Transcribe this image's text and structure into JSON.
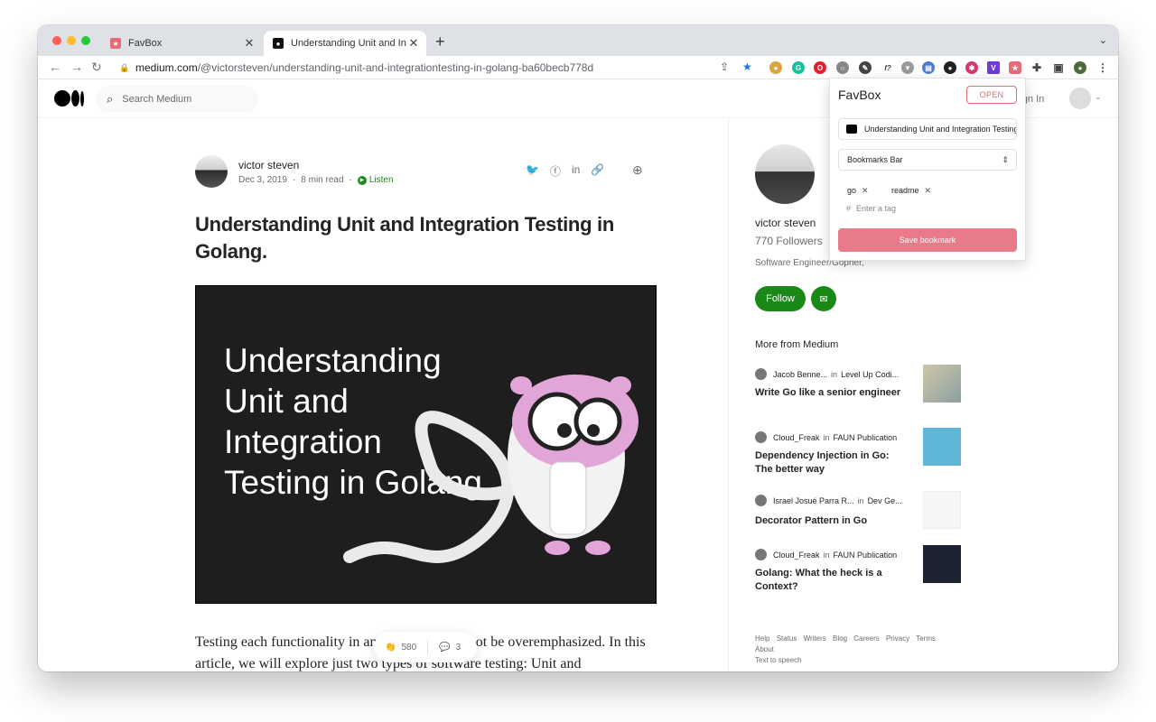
{
  "browser": {
    "tabs": [
      {
        "title": "FavBox",
        "favicon_color": "#e56b79"
      },
      {
        "title": "Understanding Unit and Integr",
        "favicon_color": "#111111"
      }
    ],
    "new_tab": "+",
    "tab_menu": "⌄",
    "url_host": "medium.com",
    "url_path": "/@victorsteven/understanding-unit-and-integrationtesting-in-golang-ba60becb778d",
    "traffic_colors": [
      "#ff5f57",
      "#febc2e",
      "#28c840"
    ]
  },
  "medium": {
    "search_placeholder": "Search Medium",
    "sign_in": "Sign In",
    "article": {
      "author": "victor steven",
      "date": "Dec 3, 2019",
      "read_time": "8 min read",
      "listen": "Listen",
      "title": "Understanding Unit and Integration Testing in Golang.",
      "hero_text": "Understanding Unit and Integration Testing in Golang",
      "body": "Testing each functionality in an application cannot be overemphasized. In this article, we will explore just two types of software testing: Unit and",
      "claps": "580",
      "comments": "3"
    },
    "sidebar": {
      "name": "victor steven",
      "followers": "770 Followers",
      "bio": "Software Engineer/Gopher,",
      "follow": "Follow",
      "more_from": "More from Medium",
      "recs": [
        {
          "author": "Jacob Benne...",
          "in": "in",
          "pub": "Level Up Codi...",
          "title": "Write Go like a senior engineer"
        },
        {
          "author": "Cloud_Freak",
          "in": "in",
          "pub": "FAUN Publication",
          "title": "Dependency Injection in Go: The better way"
        },
        {
          "author": "Israel Josué Parra R...",
          "in": "in",
          "pub": "Dev Ge...",
          "title": "Decorator Pattern in Go"
        },
        {
          "author": "Cloud_Freak",
          "in": "in",
          "pub": "FAUN Publication",
          "title": "Golang: What the heck is a Context?"
        }
      ],
      "footer": [
        "Help",
        "Status",
        "Writers",
        "Blog",
        "Careers",
        "Privacy",
        "Terms",
        "About",
        "Text to speech"
      ]
    }
  },
  "favbox": {
    "title": "FavBox",
    "open": "OPEN",
    "page_title": "Understanding Unit and Integration Testing",
    "folder": "Bookmarks Bar",
    "tags": [
      "go",
      "readme"
    ],
    "tag_placeholder": "Enter a tag",
    "save": "Save bookmark",
    "accent": "#e87a89"
  }
}
